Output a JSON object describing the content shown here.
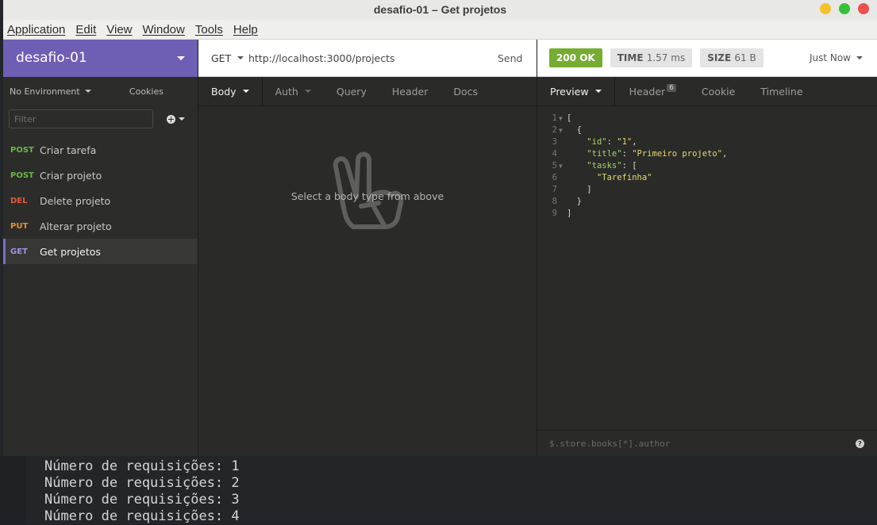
{
  "window": {
    "title": "desafio-01 – Get projetos"
  },
  "menu": [
    "Application",
    "Edit",
    "View",
    "Window",
    "Tools",
    "Help"
  ],
  "sidebar": {
    "workspace": "desafio-01",
    "environment": "No Environment",
    "cookies": "Cookies",
    "filter_placeholder": "Filter",
    "requests": [
      {
        "method": "POST",
        "name": "Criar tarefa"
      },
      {
        "method": "POST",
        "name": "Criar projeto"
      },
      {
        "method": "DEL",
        "name": "Delete projeto"
      },
      {
        "method": "PUT",
        "name": "Alterar projeto"
      },
      {
        "method": "GET",
        "name": "Get projetos"
      }
    ]
  },
  "request": {
    "method": "GET",
    "url": "http://localhost:3000/projects",
    "send_label": "Send",
    "tabs": [
      "Body",
      "Auth",
      "Query",
      "Header",
      "Docs"
    ],
    "empty_message": "Select a body type from above"
  },
  "response": {
    "status": "200 OK",
    "time_label": "TIME",
    "time_value": "1.57 ms",
    "size_label": "SIZE",
    "size_value": "61 B",
    "when": "Just Now",
    "tabs": [
      "Preview",
      "Header",
      "Cookie",
      "Timeline"
    ],
    "header_count": "6",
    "filter_placeholder": "$.store.books[*].author",
    "help": "?"
  },
  "terminal": {
    "lines": [
      "Número de requisições: 1",
      "Número de requisições: 2",
      "Número de requisições: 3",
      "Número de requisições: 4"
    ]
  },
  "colors": {
    "workspace": "#6f5fb4",
    "post": "#68b845",
    "del": "#e6573c",
    "put": "#e88f2d",
    "get": "#9f93d9",
    "status_ok": "#77ac32"
  }
}
